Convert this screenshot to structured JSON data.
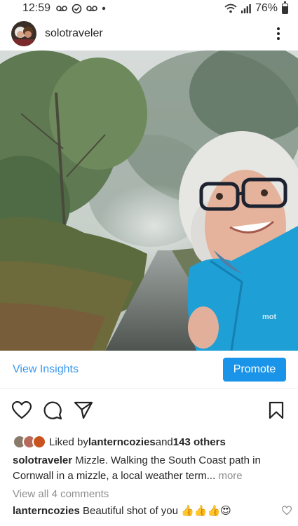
{
  "status": {
    "time": "12:59",
    "battery": "76%",
    "battery_level": 0.76,
    "icons": [
      "voicemail-icon",
      "check-circle-icon",
      "voicemail-icon",
      "dot-icon",
      "wifi-icon",
      "signal-icon",
      "battery-icon"
    ]
  },
  "post": {
    "username": "solotraveler",
    "more_icon": "more-vertical-icon"
  },
  "insights": {
    "view_label": "View Insights",
    "promote_label": "Promote"
  },
  "actions": [
    "heart-icon",
    "comment-icon",
    "share-icon",
    "bookmark-icon"
  ],
  "likes": {
    "prefix": "Liked by ",
    "user": "lanterncozies",
    "middle": " and ",
    "others": "143 others"
  },
  "caption": {
    "user": "solotraveler",
    "text": " Mizzle. Walking the South Coast path in Cornwall in a mizzle, a local weather term...",
    "more": " more"
  },
  "comments": {
    "view_all": "View all 4 comments",
    "first_user": "lanterncozies",
    "first_text": " Beautiful shot of you 👍👍👍😍"
  },
  "colors": {
    "accent": "#3897f0",
    "promote": "#1a94e8",
    "jacket": "#1e9fd6"
  }
}
